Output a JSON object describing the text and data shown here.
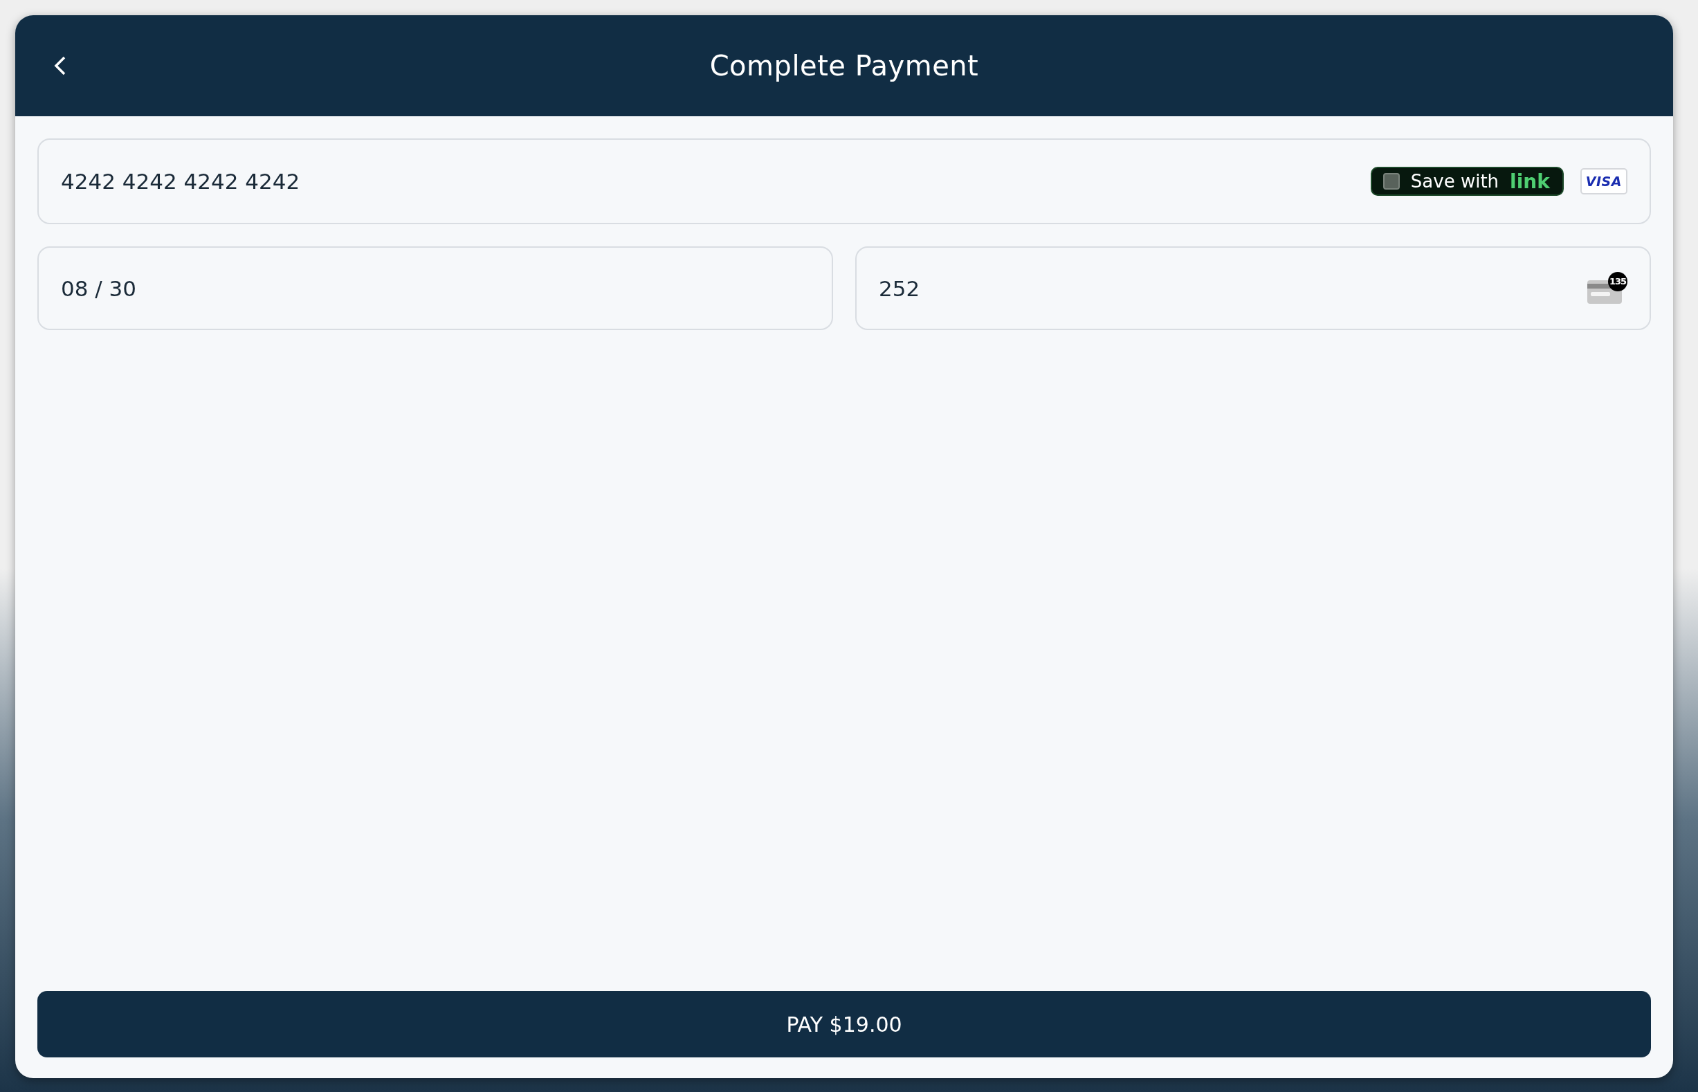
{
  "header": {
    "title": "Complete Payment"
  },
  "card_number": {
    "value": "4242 4242 4242 4242",
    "save": {
      "label": "Save with",
      "brand": "link",
      "checked": false
    },
    "card_brand": "VISA"
  },
  "expiry": {
    "value": "08 / 30"
  },
  "cvc": {
    "value": "252",
    "hint_badge": "135"
  },
  "pay_button": {
    "label": "PAY $19.00"
  }
}
